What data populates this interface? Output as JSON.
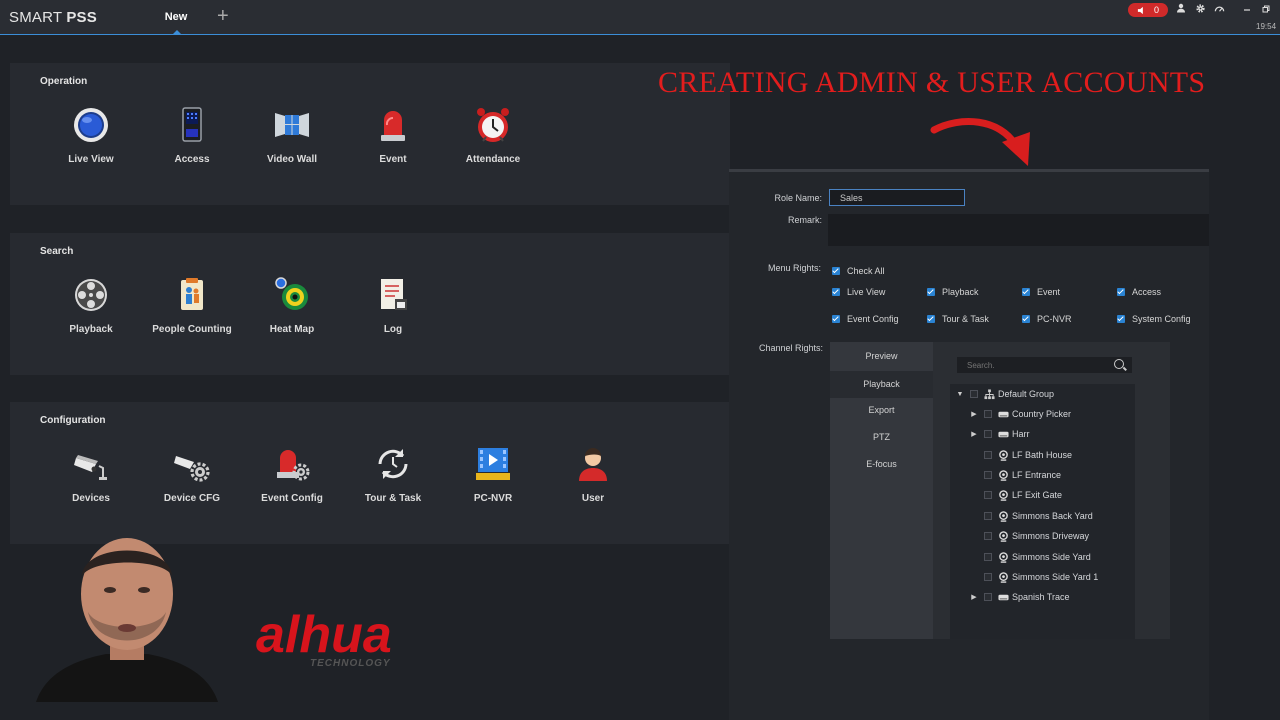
{
  "app": {
    "brand_light": "SMART ",
    "brand_bold": "PSS",
    "tab_new": "New",
    "tab_add": "+",
    "alarm_count": "0",
    "clock": "19:54"
  },
  "operation": {
    "title": "Operation",
    "items": [
      {
        "label": "Live View",
        "icon": "live-view-icon"
      },
      {
        "label": "Access",
        "icon": "access-icon"
      },
      {
        "label": "Video Wall",
        "icon": "video-wall-icon"
      },
      {
        "label": "Event",
        "icon": "event-icon"
      },
      {
        "label": "Attendance",
        "icon": "attendance-icon"
      }
    ]
  },
  "search": {
    "title": "Search",
    "items": [
      {
        "label": "Playback",
        "icon": "playback-icon"
      },
      {
        "label": "People Counting",
        "icon": "people-counting-icon"
      },
      {
        "label": "Heat Map",
        "icon": "heat-map-icon"
      },
      {
        "label": "Log",
        "icon": "log-icon"
      }
    ]
  },
  "configuration": {
    "title": "Configuration",
    "items": [
      {
        "label": "Devices",
        "icon": "devices-icon"
      },
      {
        "label": "Device CFG",
        "icon": "device-cfg-icon"
      },
      {
        "label": "Event Config",
        "icon": "event-config-icon"
      },
      {
        "label": "Tour & Task",
        "icon": "tour-task-icon"
      },
      {
        "label": "PC-NVR",
        "icon": "pc-nvr-icon"
      },
      {
        "label": "User",
        "icon": "user-icon"
      }
    ]
  },
  "overlay": {
    "headline": "CREATING ADMIN & USER ACCOUNTS",
    "headline_color": "#e21d1d"
  },
  "role_form": {
    "role_name_label": "Role Name:",
    "role_name_value": "Sales",
    "remark_label": "Remark:",
    "menu_rights_label": "Menu Rights:",
    "check_all": "Check All",
    "menu_rights": [
      "Live View",
      "Playback",
      "Event",
      "Access",
      "Event Config",
      "Tour & Task",
      "PC-NVR",
      "System Config"
    ],
    "channel_rights_label": "Channel Rights:",
    "channel_tabs": [
      "Preview",
      "Playback",
      "Export",
      "PTZ",
      "E-focus"
    ],
    "search_placeholder": "Search.",
    "tree": [
      {
        "label": "Default Group",
        "type": "group"
      },
      {
        "label": "Country Picker",
        "type": "device"
      },
      {
        "label": "Harr",
        "type": "device"
      },
      {
        "label": "LF Bath House",
        "type": "camera"
      },
      {
        "label": "LF Entrance",
        "type": "camera"
      },
      {
        "label": "LF Exit Gate",
        "type": "camera"
      },
      {
        "label": "Simmons Back Yard",
        "type": "camera"
      },
      {
        "label": "Simmons Driveway",
        "type": "camera"
      },
      {
        "label": "Simmons Side Yard",
        "type": "camera"
      },
      {
        "label": "Simmons Side Yard 1",
        "type": "camera"
      },
      {
        "label": "Spanish Trace",
        "type": "device"
      }
    ]
  },
  "logo": {
    "text": "alhua",
    "subtext": "TECHNOLOGY",
    "color": "#d8141c"
  }
}
